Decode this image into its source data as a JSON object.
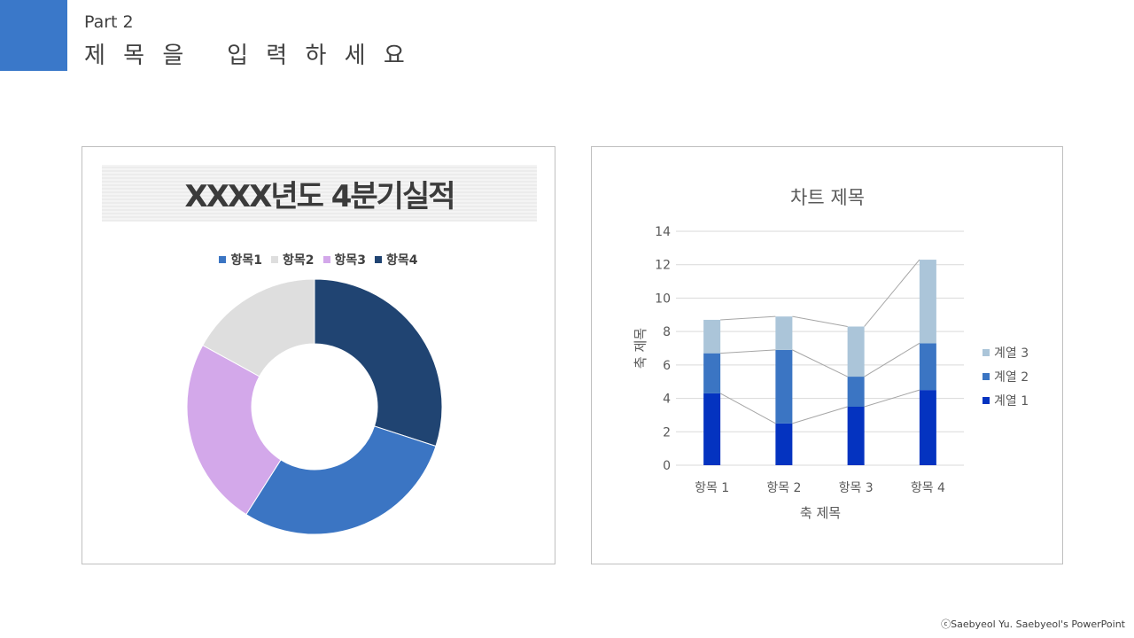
{
  "header": {
    "part": "Part 2",
    "title": "제 목 을   입 력 하 세 요",
    "accent_color": "#3a78c9"
  },
  "footer": {
    "credit": "ⓒSaebyeol Yu.  Saebyeol's PowerPoint"
  },
  "chart_data": [
    {
      "type": "pie",
      "style": "donut",
      "title": "XXXX년도 4분기실적",
      "legend_position": "top",
      "categories": [
        "항목1",
        "항목2",
        "항목3",
        "항목4"
      ],
      "values": [
        29,
        17,
        24,
        30
      ],
      "colors": [
        "#3b75c3",
        "#dedede",
        "#d3a8ea",
        "#204472"
      ]
    },
    {
      "type": "bar",
      "stacked": true,
      "title": "차트 제목",
      "xlabel": "축 제목",
      "ylabel": "축 제목",
      "ylim": [
        0,
        14
      ],
      "yticks": [
        0,
        2,
        4,
        6,
        8,
        10,
        12,
        14
      ],
      "grid": true,
      "legend_position": "right",
      "series_lines": true,
      "categories": [
        "항목 1",
        "항목 2",
        "항목 3",
        "항목 4"
      ],
      "series": [
        {
          "name": "계열 1",
          "values": [
            4.3,
            2.5,
            3.5,
            4.5
          ],
          "color": "#0433c0"
        },
        {
          "name": "계열 2",
          "values": [
            2.4,
            4.4,
            1.8,
            2.8
          ],
          "color": "#3b75c3"
        },
        {
          "name": "계열 3",
          "values": [
            2.0,
            2.0,
            3.0,
            5.0
          ],
          "color": "#abc5d9"
        }
      ]
    }
  ]
}
